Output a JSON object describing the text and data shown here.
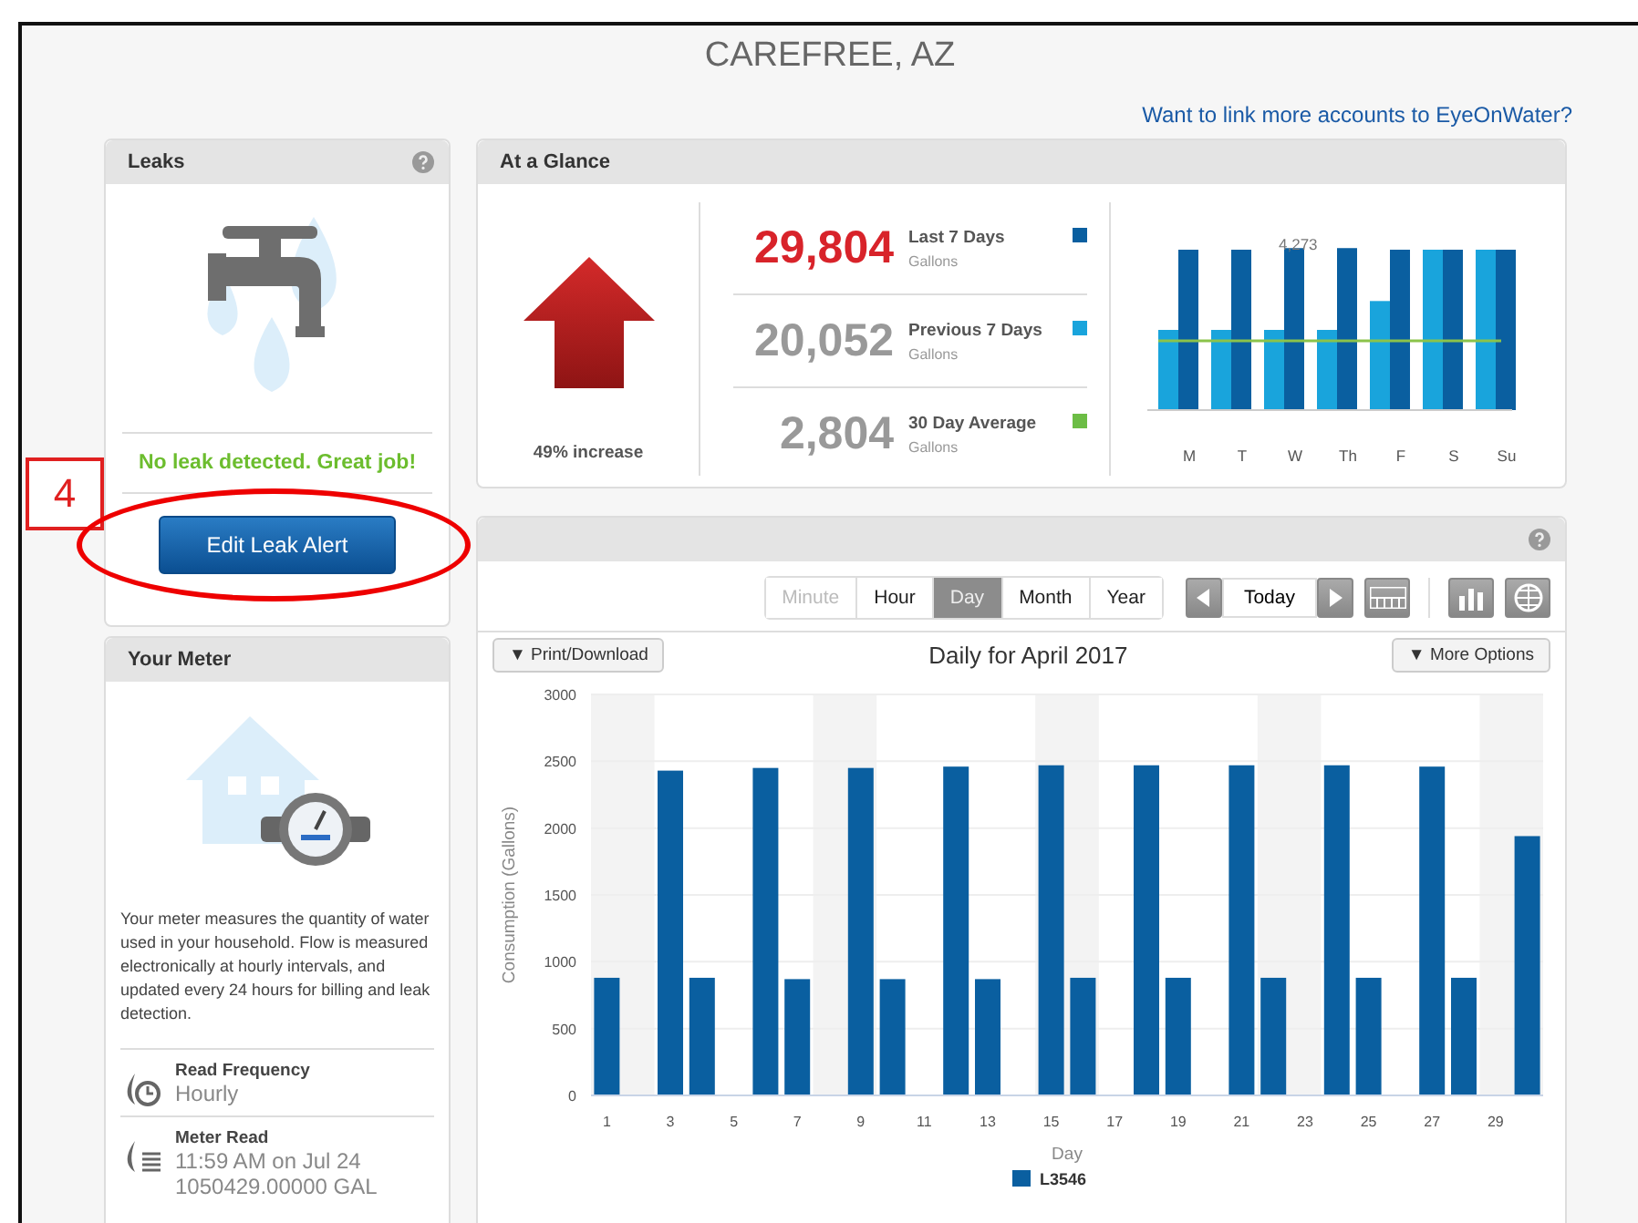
{
  "page_title": "CAREFREE, AZ",
  "link": "Want to link more accounts to EyeOnWater?",
  "leaks": {
    "title": "Leaks",
    "status": "No leak detected. Great job!",
    "button": "Edit Leak Alert"
  },
  "callout": {
    "number": "4"
  },
  "meter": {
    "title": "Your Meter",
    "description": "Your meter measures the quantity of water used in your household. Flow is measured electronically at hourly intervals, and updated every 24 hours for billing and leak detection.",
    "details": [
      {
        "kind": "frequency",
        "label": "Read Frequency",
        "values": [
          "Hourly"
        ]
      },
      {
        "kind": "read",
        "label": "Meter Read",
        "values": [
          "11:59 AM on Jul 24",
          "1050429.00000 GAL"
        ]
      }
    ]
  },
  "glance": {
    "title": "At a Glance",
    "change": "49% increase",
    "stats": [
      {
        "value": "29,804",
        "label": "Last 7 Days",
        "unit": "Gallons",
        "color": "#0a5fa0",
        "highlight": true
      },
      {
        "value": "20,052",
        "label": "Previous 7 Days",
        "unit": "Gallons",
        "color": "#19a4dc",
        "highlight": false
      },
      {
        "value": "2,804",
        "label": "30 Day Average",
        "unit": "Gallons",
        "color": "#6cbd45",
        "highlight": false
      }
    ],
    "mini_chart": {
      "peak_label": "4,273",
      "days": [
        "M",
        "T",
        "W",
        "Th",
        "F",
        "S",
        "Su"
      ]
    }
  },
  "usage": {
    "periods": [
      {
        "label": "Minute",
        "disabled": true,
        "selected": false
      },
      {
        "label": "Hour",
        "disabled": false,
        "selected": false
      },
      {
        "label": "Day",
        "disabled": false,
        "selected": true
      },
      {
        "label": "Month",
        "disabled": false,
        "selected": false
      },
      {
        "label": "Year",
        "disabled": false,
        "selected": false
      }
    ],
    "today": "Today",
    "print": "▼ Print/Download",
    "more": "▼ More Options",
    "chart_data": {
      "type": "bar",
      "title": "Daily for April 2017",
      "xlabel": "Day",
      "ylabel": "Consumption (Gallons)",
      "x": [
        1,
        2,
        3,
        4,
        5,
        6,
        7,
        8,
        9,
        10,
        11,
        12,
        13,
        14,
        15,
        16,
        17,
        18,
        19,
        20,
        21,
        22,
        23,
        24,
        25,
        26,
        27,
        28,
        29,
        30
      ],
      "grid": true,
      "series": [
        {
          "name": "L3546",
          "color": "#0a5fa0",
          "values": [
            880,
            0,
            2430,
            880,
            0,
            2450,
            870,
            0,
            2450,
            870,
            0,
            2460,
            870,
            0,
            2470,
            880,
            0,
            2470,
            880,
            0,
            2470,
            880,
            0,
            2470,
            880,
            0,
            2460,
            880,
            0,
            1940
          ]
        }
      ],
      "ylim": [
        0,
        3000
      ],
      "yticks": [
        0,
        500,
        1000,
        1500,
        2000,
        2500,
        3000
      ],
      "xlim": [
        0.5,
        30.5
      ],
      "bands": [
        {
          "axis": "x",
          "from": 0.5,
          "to": 2.5
        },
        {
          "axis": "x",
          "from": 7.5,
          "to": 9.5
        },
        {
          "axis": "x",
          "from": 14.5,
          "to": 16.5
        },
        {
          "axis": "x",
          "from": 21.5,
          "to": 23.5
        },
        {
          "axis": "x",
          "from": 28.5,
          "to": 30.5
        }
      ],
      "xticks": [
        1,
        3,
        5,
        7,
        9,
        11,
        13,
        15,
        17,
        19,
        21,
        23,
        25,
        27,
        29
      ]
    }
  }
}
